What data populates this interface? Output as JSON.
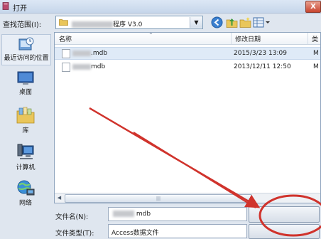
{
  "window": {
    "title": "打开",
    "close_label": "X"
  },
  "lookin": {
    "label": "查找范围(I):",
    "value_visible": "程序 V3.0"
  },
  "toolbar": {
    "icons": [
      "back-icon",
      "up-folder-icon",
      "new-folder-icon",
      "view-menu-icon"
    ]
  },
  "places": [
    {
      "id": "recent",
      "label": "最近访问的位置",
      "icon": "recent-places-icon"
    },
    {
      "id": "desktop",
      "label": "桌面",
      "icon": "desktop-icon"
    },
    {
      "id": "library",
      "label": "库",
      "icon": "library-icon"
    },
    {
      "id": "computer",
      "label": "计算机",
      "icon": "computer-icon"
    },
    {
      "id": "network",
      "label": "网络",
      "icon": "network-icon"
    }
  ],
  "list": {
    "headers": {
      "name": "名称",
      "date": "修改日期",
      "type": "类"
    },
    "rows": [
      {
        "name_visible": ".mdb",
        "date": "2015/3/23 13:09",
        "type": "M",
        "selected": true
      },
      {
        "name_visible": "mdb",
        "date": "2013/12/11 12:50",
        "type": "M",
        "selected": false
      }
    ]
  },
  "filename": {
    "label": "文件名(N):",
    "value_visible": "mdb"
  },
  "filetype": {
    "label": "文件类型(T):",
    "value": "Access数据文件"
  },
  "annotation": {
    "arrow_color": "#d0332c",
    "circle_color": "#d0332c"
  }
}
